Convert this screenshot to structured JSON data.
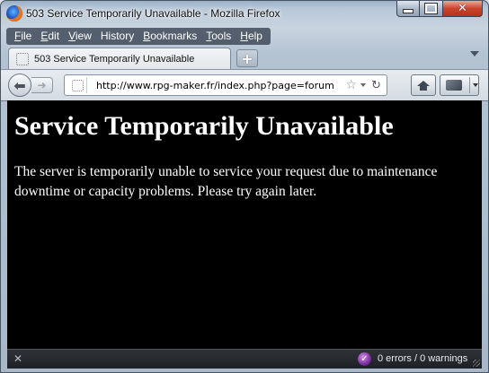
{
  "window": {
    "title": "503 Service Temporarily Unavailable - Mozilla Firefox"
  },
  "menubar": {
    "items": [
      {
        "accel": "F",
        "rest": "ile"
      },
      {
        "accel": "E",
        "rest": "dit"
      },
      {
        "accel": "V",
        "rest": "iew"
      },
      {
        "accel": "",
        "rest": "History",
        "accel_pos": "S",
        "full": "History"
      },
      {
        "accel": "B",
        "rest": "ookmarks"
      },
      {
        "accel": "T",
        "rest": "ools"
      },
      {
        "accel": "H",
        "rest": "elp"
      }
    ]
  },
  "tabs": [
    {
      "title": "503 Service Temporarily Unavailable"
    }
  ],
  "newtab_label": "+",
  "navbar": {
    "url": "http://www.rpg-maker.fr/index.php?page=forum"
  },
  "page": {
    "heading": "Service Temporarily Unavailable",
    "body": "The server is temporarily unable to service your request due to maintenance downtime or capacity problems. Please try again later."
  },
  "statusbar": {
    "close_glyph": "✕",
    "errors_text": "0 errors / 0 warnings"
  },
  "colors": {
    "page_background": "#000000",
    "page_text": "#ffffff",
    "close_button": "#c8452d"
  }
}
